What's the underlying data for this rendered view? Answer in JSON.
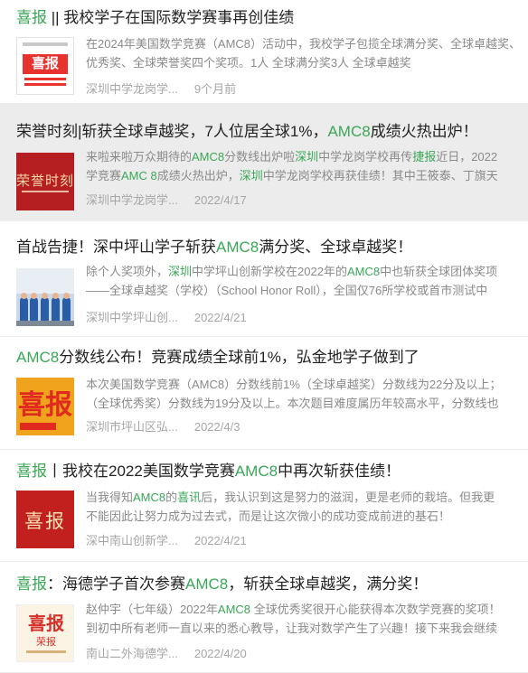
{
  "colors": {
    "accent": "#3aa757",
    "title": "#222222",
    "desc": "#8a8a8a",
    "meta": "#a6a6a6",
    "highlight_bg": "#ececec"
  },
  "items": [
    {
      "title_accent": "喜报",
      "title_rest": " || 我校学子在国际数学赛事再创佳绩",
      "desc_line1": "在2024年美国数学竞赛（AMC8）活动中，我校学子包揽全球满分奖、全球卓越奖、",
      "desc_line2": "优秀奖、全球荣誉奖四个奖项。1人 全球满分奖3人 全球卓越奖",
      "source": "深圳中学龙岗学...",
      "date": "9个月前",
      "thumb_label": "喜报"
    },
    {
      "title_pre": "荣誉时刻|斩获全球卓越奖，7人位居全球1%，",
      "title_accent": "AMC8",
      "title_post": "成绩火热出炉！",
      "desc_line1_a": "来啦来啦万众期待的",
      "desc_line1_b": "AMC8",
      "desc_line1_c": "分数线出炉啦",
      "desc_line1_d": "深圳",
      "desc_line1_e": "中学龙岗学校再传",
      "desc_line1_f": "捷报",
      "desc_line1_g": "近日，2022",
      "desc_line2_a": "学竞赛",
      "desc_line2_b": "AMC 8",
      "desc_line2_c": "成绩火热出炉，",
      "desc_line2_d": "深圳",
      "desc_line2_e": "中学龙岗学校再获佳绩！其中王筱泰、丁旗天",
      "source": "深圳中学龙岗学...",
      "date": "2022/4/17",
      "thumb_label": "荣誉时刻"
    },
    {
      "title_pre": "首战告捷！深中坪山学子斩获",
      "title_accent": "AMC8",
      "title_post": "满分奖、全球卓越奖！",
      "desc_line1_a": "除个人奖项外，",
      "desc_line1_b": "深圳",
      "desc_line1_c": "中学坪山创新学校在2022年的",
      "desc_line1_d": "AMC8",
      "desc_line1_e": "中也斩获全球团体奖项",
      "desc_line2": "——全球卓越奖（学校）（School Honor Roll），全国仅76所学校或首市测试中",
      "source": "深圳中学坪山创...",
      "date": "2022/4/21"
    },
    {
      "title_accent": "AMC8",
      "title_rest": "分数线公布！竞赛成绩全球前1%，弘金地学子做到了",
      "desc_line1": "本次美国数学竞赛（AMC8）分数线前1%（全球卓越奖）分数线为22分及以上；",
      "desc_line2": "（全球优秀奖）分数线为19分及以上。本次题目难度属历年较高水平，分数线也",
      "source": "深圳市坪山区弘...",
      "date": "2022/4/3",
      "thumb_label": "喜报"
    },
    {
      "title_accent": "喜报",
      "title_mid": "丨我校在2022美国数学竞赛",
      "title_accent2": "AMC8",
      "title_post": "中再次斩获佳绩！",
      "desc_line1_a": "当我得知",
      "desc_line1_b": "AMC8",
      "desc_line1_c": "的",
      "desc_line1_d": "喜讯",
      "desc_line1_e": "后，我认识到这是努力的滋润，更是老师的栽培。但我更",
      "desc_line2": "不能因此让努力成为过去式，而是让这次微小的成功变成前进的基石！",
      "source": "深中南山创新学...",
      "date": "2022/4/21",
      "thumb_label": "喜报"
    },
    {
      "title_accent": "喜报",
      "title_mid": "：海德学子首次参赛",
      "title_accent2": "AMC8",
      "title_post": "，斩获全球卓越奖，满分奖！",
      "desc_line1_a": "赵仲宇（七年级）2022年",
      "desc_line1_b": "AMC8",
      "desc_line1_c": " 全球优秀奖很开心能获得本次数学竞赛的奖项！",
      "desc_line2": "到初中所有老师一直以来的悉心教导，让我对数学产生了兴趣！接下来我会继续",
      "source": "南山二外海德学...",
      "date": "2022/4/20",
      "thumb_label": "喜报",
      "thumb_sub": "荣报"
    }
  ]
}
